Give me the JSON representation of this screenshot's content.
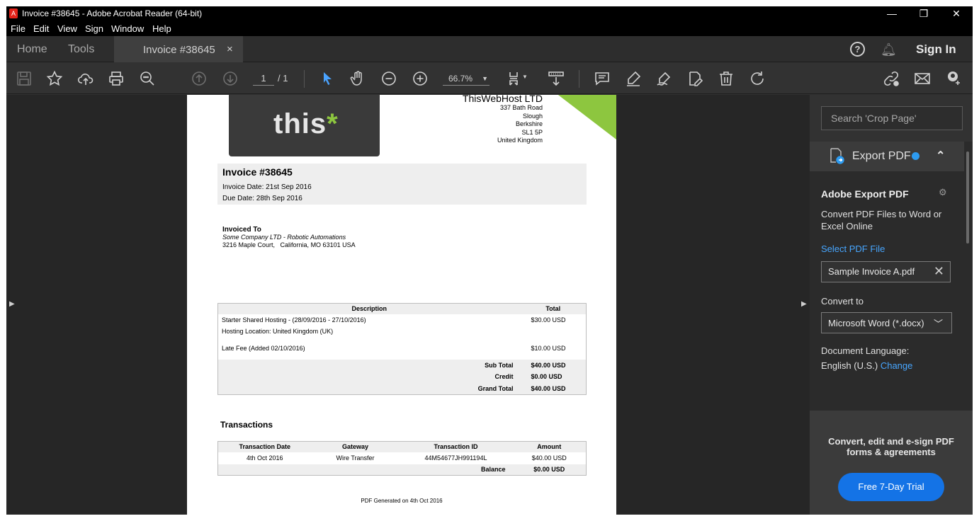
{
  "window": {
    "title": "Invoice #38645 - Adobe Acrobat Reader (64-bit)",
    "minimize": "—",
    "maximize": "❐",
    "close": "✕"
  },
  "menu": [
    "File",
    "Edit",
    "View",
    "Sign",
    "Window",
    "Help"
  ],
  "tabs": {
    "home": "Home",
    "tools": "Tools",
    "doc": "Invoice #38645",
    "doc_close": "×",
    "help": "?",
    "signin": "Sign In"
  },
  "toolbar": {
    "page_current": "1",
    "page_total": "/ 1",
    "zoom": "66.7%",
    "icons": [
      "save-icon",
      "bookmark-star-icon",
      "upload-cloud-icon",
      "print-icon",
      "find-icon",
      "page-up-icon",
      "page-down-icon",
      "select-arrow-icon",
      "hand-icon",
      "zoom-out-icon",
      "zoom-in-icon",
      "page-fit-icon",
      "scroll-mode-icon",
      "comment-icon",
      "highlight-icon",
      "sign-icon",
      "edit-pdf-icon",
      "delete-icon",
      "rotate-icon",
      "share-link-icon",
      "email-icon",
      "add-user-icon"
    ]
  },
  "invoice": {
    "logo_text": "this",
    "logo_star": "*",
    "company_name": "ThisWebHost LTD",
    "address": [
      "337 Bath Road",
      "Slough",
      "Berkshire",
      "SL1 5P",
      "United Kingdom"
    ],
    "title": "Invoice #38645",
    "invoice_date": "Invoice Date: 21st Sep 2016",
    "due_date": "Due Date: 28th Sep 2016",
    "invoiced_to_label": "Invoiced To",
    "client_name": "Some Company LTD - Robotic Automations",
    "client_address": "3216 Maple Court,   California, MO 63101 USA",
    "items_header": {
      "description": "Description",
      "total": "Total"
    },
    "items": [
      {
        "description": "Starter Shared Hosting - (28/09/2016 - 27/10/2016)",
        "total": "$30.00 USD"
      },
      {
        "description": "Hosting Location: United Kingdom (UK)",
        "total": ""
      },
      {
        "description": "Late Fee (Added 02/10/2016)",
        "total": "$10.00 USD"
      }
    ],
    "totals": [
      {
        "label": "Sub Total",
        "value": "$40.00 USD"
      },
      {
        "label": "Credit",
        "value": "$0.00 USD"
      },
      {
        "label": "Grand Total",
        "value": "$40.00 USD"
      }
    ],
    "transactions_title": "Transactions",
    "tx_header": {
      "date": "Transaction Date",
      "gateway": "Gateway",
      "id": "Transaction ID",
      "amount": "Amount"
    },
    "tx_rows": [
      {
        "date": "4th Oct 2016",
        "gateway": "Wire Transfer",
        "id": "44M54677JH991194L",
        "amount": "$40.00 USD"
      }
    ],
    "balance_label": "Balance",
    "balance_value": "$0.00 USD",
    "generated": "PDF Generated on 4th Oct 2016"
  },
  "panel": {
    "search_placeholder": "Search 'Crop Page'",
    "export_title": "Export PDF",
    "heading": "Adobe Export PDF",
    "description": "Convert PDF Files to Word or Excel Online",
    "select_link": "Select PDF File",
    "file_name": "Sample Invoice A.pdf",
    "convert_to_label": "Convert to",
    "convert_to_value": "Microsoft Word (*.docx)",
    "doc_lang_label": "Document Language:",
    "doc_lang_value": "English (U.S.)",
    "change_link": "Change",
    "promo_text": "Convert, edit and e-sign PDF forms & agreements",
    "trial_button": "Free 7-Day Trial"
  },
  "colors": {
    "accent_blue": "#1473e6",
    "link_blue": "#47a6ff",
    "logo_green": "#8dc63f",
    "acrobat_red": "#e2231a"
  }
}
